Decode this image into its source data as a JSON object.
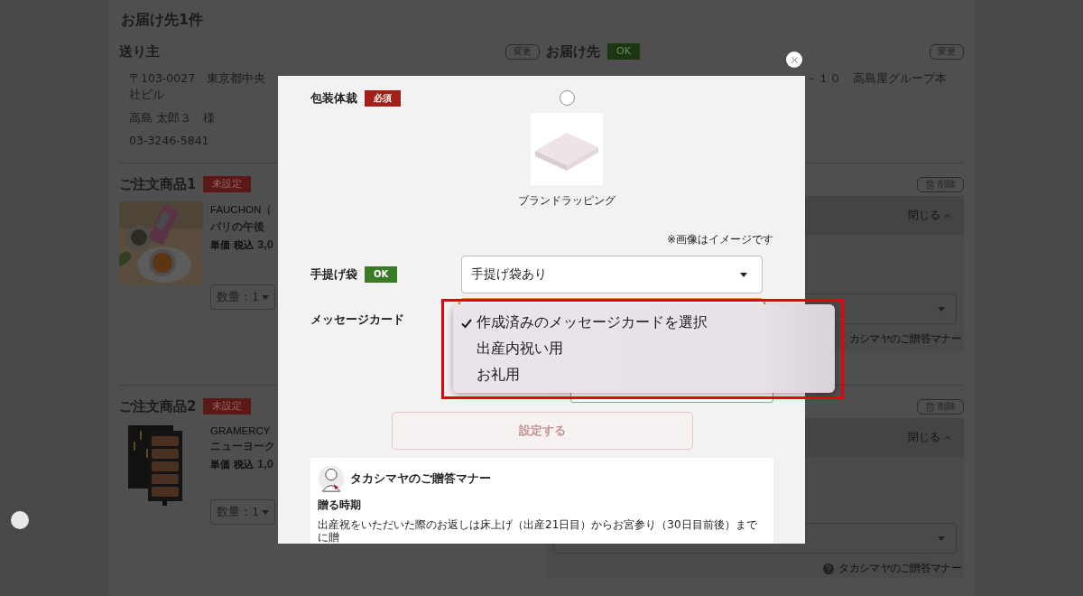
{
  "page_title": "お届け先1件",
  "sender": {
    "heading": "送り主",
    "change_button": "変更",
    "address_line1": "〒103-0027　東京都中央",
    "address_line2": "社ビル",
    "name": "高島 太郎３　様",
    "phone": "03-3246-5841"
  },
  "recipient": {
    "heading": "お届け先",
    "status": {
      "label": "OK",
      "kind": "ok"
    },
    "change_button": "変更",
    "address_fragment": "－１０　高島屋グループ本"
  },
  "order_items": [
    {
      "heading": "ご注文商品1",
      "status": {
        "label": "未設定",
        "kind": "unset"
      },
      "brand": "FAUCHON（",
      "name": "パリの午後",
      "price_label": "単価",
      "tax_label": "税込",
      "price": "3,0",
      "quantity": "数量：1",
      "delete_button": "削除",
      "collapse_button": "閉じる",
      "manners_link": "カシマヤのご贈答マナー",
      "help_icon": false
    },
    {
      "heading": "ご注文商品2",
      "status": {
        "label": "未設定",
        "kind": "unset"
      },
      "brand": "GRAMERCY",
      "name": "ニューヨーク",
      "price_label": "単価",
      "tax_label": "税込",
      "price": "1,0",
      "quantity": "数量：1",
      "delete_button": "削除",
      "collapse_button": "閉じる",
      "manners_link": "タカシマヤのご贈答マナー",
      "help_icon": true
    }
  ],
  "modal": {
    "wrapping": {
      "label": "包装体裁",
      "badge": {
        "label": "必須",
        "kind": "required"
      },
      "options": [
        {
          "caption": "ブランドラッピング",
          "selected": false
        }
      ],
      "note": "※画像はイメージです"
    },
    "bag": {
      "label": "手提げ袋",
      "badge": {
        "label": "OK",
        "kind": "ok"
      },
      "value": "手提げ袋あり"
    },
    "message_card": {
      "label": "メッセージカード",
      "menu": [
        {
          "label": "作成済みのメッセージカードを選択",
          "selected": true
        },
        {
          "label": "出産内祝い用",
          "selected": false
        },
        {
          "label": "お礼用",
          "selected": false
        }
      ]
    },
    "submit_button": {
      "label": "設定する",
      "disabled": true
    },
    "manners": {
      "title": "タカシマヤのご贈答マナー",
      "section_heading": "贈る時期",
      "text": "出産祝をいただいた際のお返しは床上げ（出産21日目）からお宮参り（30日目前後）までに贈"
    }
  }
}
